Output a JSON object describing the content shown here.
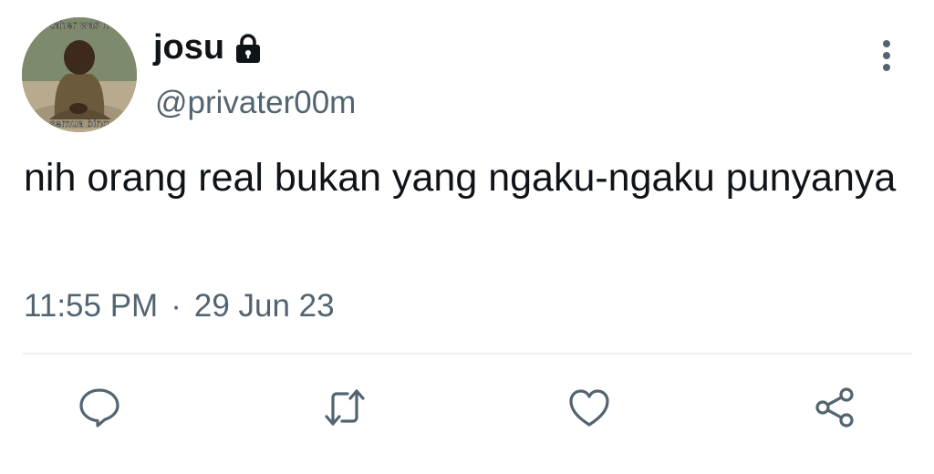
{
  "user": {
    "display_name": "josu",
    "handle": "@privater00m",
    "protected": true,
    "avatar_caption_top": "taher was h",
    "avatar_caption_bottom": "semua bing"
  },
  "tweet": {
    "text": "nih orang real bukan yang ngaku-ngaku punyanya",
    "time": "11:55 PM",
    "separator": "·",
    "date": "29 Jun 23"
  },
  "actions": [
    {
      "name": "reply",
      "icon": "reply-icon"
    },
    {
      "name": "retweet",
      "icon": "retweet-icon"
    },
    {
      "name": "like",
      "icon": "heart-icon"
    },
    {
      "name": "share",
      "icon": "share-icon"
    }
  ],
  "colors": {
    "text_primary": "#0f1419",
    "text_secondary": "#536471",
    "divider": "#eff3f4",
    "background": "#ffffff"
  }
}
